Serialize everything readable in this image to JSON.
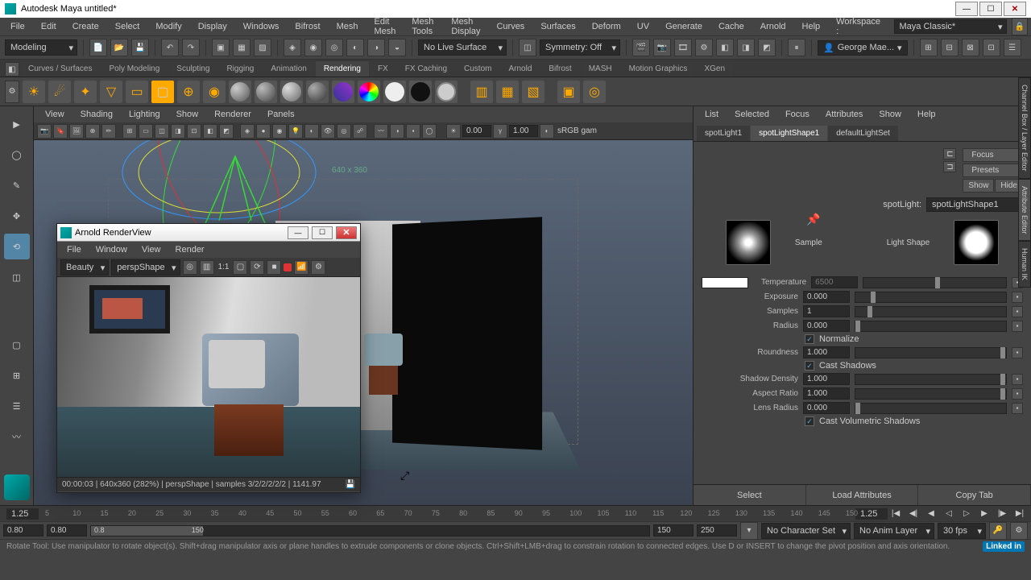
{
  "window": {
    "title": "Autodesk Maya  untitled*"
  },
  "menubar": [
    "File",
    "Edit",
    "Create",
    "Select",
    "Modify",
    "Display",
    "Windows",
    "Bifrost",
    "Mesh",
    "Edit Mesh",
    "Mesh Tools",
    "Mesh Display",
    "Curves",
    "Surfaces",
    "Deform",
    "UV",
    "Generate",
    "Cache",
    "Arnold",
    "Help"
  ],
  "workspace": {
    "label": "Workspace :",
    "value": "Maya Classic*"
  },
  "statusline": {
    "menuset": "Modeling",
    "live": "No Live Surface",
    "symmetry": "Symmetry: Off",
    "user": "George Mae..."
  },
  "shelves": [
    "Curves / Surfaces",
    "Poly Modeling",
    "Sculpting",
    "Rigging",
    "Animation",
    "Rendering",
    "FX",
    "FX Caching",
    "Custom",
    "Arnold",
    "Bifrost",
    "MASH",
    "Motion Graphics",
    "XGen"
  ],
  "active_shelf": "Rendering",
  "viewport": {
    "menus": [
      "View",
      "Shading",
      "Lighting",
      "Show",
      "Renderer",
      "Panels"
    ],
    "gamma": "0.00",
    "exposure": "1.00",
    "colorspace": "sRGB gam",
    "dims_label": "640 x 360"
  },
  "arnold": {
    "title": "Arnold RenderView",
    "menus": [
      "File",
      "Window",
      "View",
      "Render"
    ],
    "aov": "Beauty",
    "camera": "perspShape",
    "scale": "1:1",
    "status": "00:00:03 | 640x360 (282%) | perspShape | samples 3/2/2/2/2/2 | 1141.97"
  },
  "attr": {
    "menus": [
      "List",
      "Selected",
      "Focus",
      "Attributes",
      "Show",
      "Help"
    ],
    "tabs": [
      "spotLight1",
      "spotLightShape1",
      "defaultLightSet"
    ],
    "active_tab": "spotLightShape1",
    "node_label": "spotLight:",
    "node_name": "spotLightShape1",
    "header_buttons": [
      "Focus",
      "Presets"
    ],
    "show_hide": {
      "show": "Show",
      "hide": "Hide"
    },
    "swatches": {
      "sample": "Sample",
      "lightshape": "Light Shape"
    },
    "params": {
      "temperature": {
        "label": "Temperature",
        "value": "6500"
      },
      "exposure": {
        "label": "Exposure",
        "value": "0.000"
      },
      "samples": {
        "label": "Samples",
        "value": "1"
      },
      "radius": {
        "label": "Radius",
        "value": "0.000"
      },
      "normalize": "Normalize",
      "roundness": {
        "label": "Roundness",
        "value": "1.000"
      },
      "castshadows": "Cast Shadows",
      "shadowdensity": {
        "label": "Shadow Density",
        "value": "1.000"
      },
      "aspectratio": {
        "label": "Aspect Ratio",
        "value": "1.000"
      },
      "lensradius": {
        "label": "Lens Radius",
        "value": "0.000"
      },
      "castvol": "Cast Volumetric Shadows"
    },
    "footer": [
      "Select",
      "Load Attributes",
      "Copy Tab"
    ]
  },
  "side_tabs": [
    "Channel Box / Layer Editor",
    "Attribute Editor",
    "Human IK"
  ],
  "timeline": {
    "current": "1.25",
    "ticks": [
      "5",
      "10",
      "15",
      "20",
      "25",
      "30",
      "35",
      "40",
      "45",
      "50",
      "55",
      "60",
      "65",
      "70",
      "75",
      "80",
      "85",
      "90",
      "95",
      "100",
      "105",
      "110",
      "115",
      "120",
      "125",
      "130",
      "135",
      "140",
      "145",
      "150"
    ],
    "current2": "1.25"
  },
  "range": {
    "start_in": "0.80",
    "start_out": "0.80",
    "end_in": "0.8",
    "end_out": "150",
    "a": "150",
    "b": "250",
    "charset": "No Character Set",
    "animlayer": "No Anim Layer",
    "fps": "30 fps"
  },
  "help": "Rotate Tool: Use manipulator to rotate object(s). Shift+drag manipulator axis or plane handles to extrude components or clone objects. Ctrl+Shift+LMB+drag to constrain rotation to connected edges. Use D or INSERT to change the pivot position and axis orientation.",
  "linkedin": "Linked in"
}
